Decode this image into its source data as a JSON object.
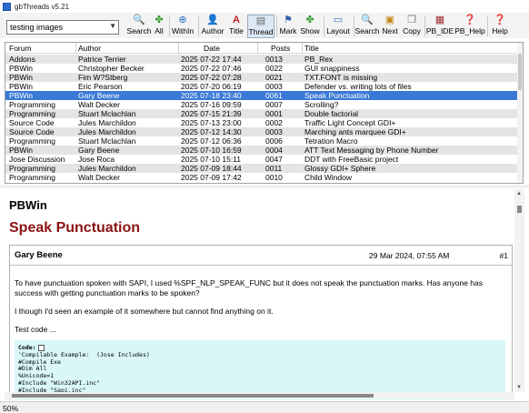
{
  "window": {
    "title": "gbThreads  v5.21"
  },
  "toolbar": {
    "search_value": "testing images",
    "buttons": [
      {
        "label": "Search",
        "icon": "magnifier-icon"
      },
      {
        "label": "All",
        "icon": "clover-icon"
      },
      {
        "label": "WithIn",
        "icon": "zoom-plus-icon"
      },
      {
        "label": "Author",
        "icon": "person-icon"
      },
      {
        "label": "Title",
        "icon": "title-a-icon"
      },
      {
        "label": "Thread",
        "icon": "document-icon"
      },
      {
        "label": "Mark",
        "icon": "flag-icon"
      },
      {
        "label": "Show",
        "icon": "clover-icon"
      },
      {
        "label": "Layout",
        "icon": "layout-icon"
      },
      {
        "label": "Search",
        "icon": "magnifier-icon"
      },
      {
        "label": "Next",
        "icon": "next-icon"
      },
      {
        "label": "Copy",
        "icon": "copy-icon"
      },
      {
        "label": "PB_IDE",
        "icon": "ide-icon"
      },
      {
        "label": "PB_Help",
        "icon": "help-icon"
      },
      {
        "label": "Help",
        "icon": "help-icon"
      }
    ]
  },
  "threads": {
    "columns": [
      "Forum",
      "Author",
      "Date",
      "Posts",
      "Title"
    ],
    "rows": [
      {
        "forum": "Addons",
        "author": "Patrice Terrier",
        "date": "2025 07-22 17:44",
        "posts": "0013",
        "title": "PB_Rex"
      },
      {
        "forum": "PBWin",
        "author": "Christopher Becker",
        "date": "2025 07-22 07:46",
        "posts": "0022",
        "title": "GUI snappiness"
      },
      {
        "forum": "PBWin",
        "author": "Fim W?Stberg",
        "date": "2025 07-22 07:28",
        "posts": "0021",
        "title": "TXT.FONT is missing"
      },
      {
        "forum": "PBWin",
        "author": "Eric Pearson",
        "date": "2025 07-20 06:19",
        "posts": "0003",
        "title": "Defender vs. writing lots of files"
      },
      {
        "forum": "PBWin",
        "author": "Gary Beene",
        "date": "2025 07-18 23:40",
        "posts": "0061",
        "title": "Speak Punctuation"
      },
      {
        "forum": "Programming",
        "author": "Walt Decker",
        "date": "2025 07-16 09:59",
        "posts": "0007",
        "title": "Scrolling?"
      },
      {
        "forum": "Programming",
        "author": "Stuart Mclachlan",
        "date": "2025 07-15 21:39",
        "posts": "0001",
        "title": "Double factorial"
      },
      {
        "forum": "Source Code",
        "author": "Jules Marchildon",
        "date": "2025 07-13 23:00",
        "posts": "0002",
        "title": "Traffic Light Concept GDI+"
      },
      {
        "forum": "Source Code",
        "author": "Jules Marchildon",
        "date": "2025 07-12 14:30",
        "posts": "0003",
        "title": "Marching ants marquee GDI+"
      },
      {
        "forum": "Programming",
        "author": "Stuart Mclachlan",
        "date": "2025 07-12 06:36",
        "posts": "0006",
        "title": "Tetration Macro"
      },
      {
        "forum": "PBWin",
        "author": "Gary Beene",
        "date": "2025 07-10 16:59",
        "posts": "0004",
        "title": "ATT Text Messaging by Phone Number"
      },
      {
        "forum": "Jose Discussion",
        "author": "Jose Roca",
        "date": "2025 07-10 15:11",
        "posts": "0047",
        "title": "DDT with FreeBasic project"
      },
      {
        "forum": "Programming",
        "author": "Jules Marchildon",
        "date": "2025 07-09 18:44",
        "posts": "0011",
        "title": "Glossy GDI+ Sphere"
      },
      {
        "forum": "Programming",
        "author": "Walt Decker",
        "date": "2025 07-09 17:42",
        "posts": "0010",
        "title": "Child Window"
      }
    ],
    "selected_index": 4
  },
  "thread_view": {
    "forum": "PBWin",
    "topic": "Speak Punctuation",
    "post": {
      "author": "Gary Beene",
      "date": "29 Mar 2024, 07:55 AM",
      "number": "#1",
      "paragraphs": [
        "To have punctuation spoken with SAPI, I used %SPF_NLP_SPEAK_FUNC but it does not speak the punctuation marks. Has anyone has success with getting punctuation marks to be spoken?",
        "I though I'd seen an example of it somewhere but cannot find anything on it.",
        "Test code ..."
      ],
      "code_label": "Code:",
      "code_lines": [
        "'Compilable Example:  (Jose Includes)",
        "#Compile Exe",
        "#Dim All",
        "%Unicode=1",
        "#Include \"Win32API.inc\"",
        "#Include \"Sapi.inc\""
      ]
    }
  },
  "status": {
    "zoom": "50%"
  }
}
